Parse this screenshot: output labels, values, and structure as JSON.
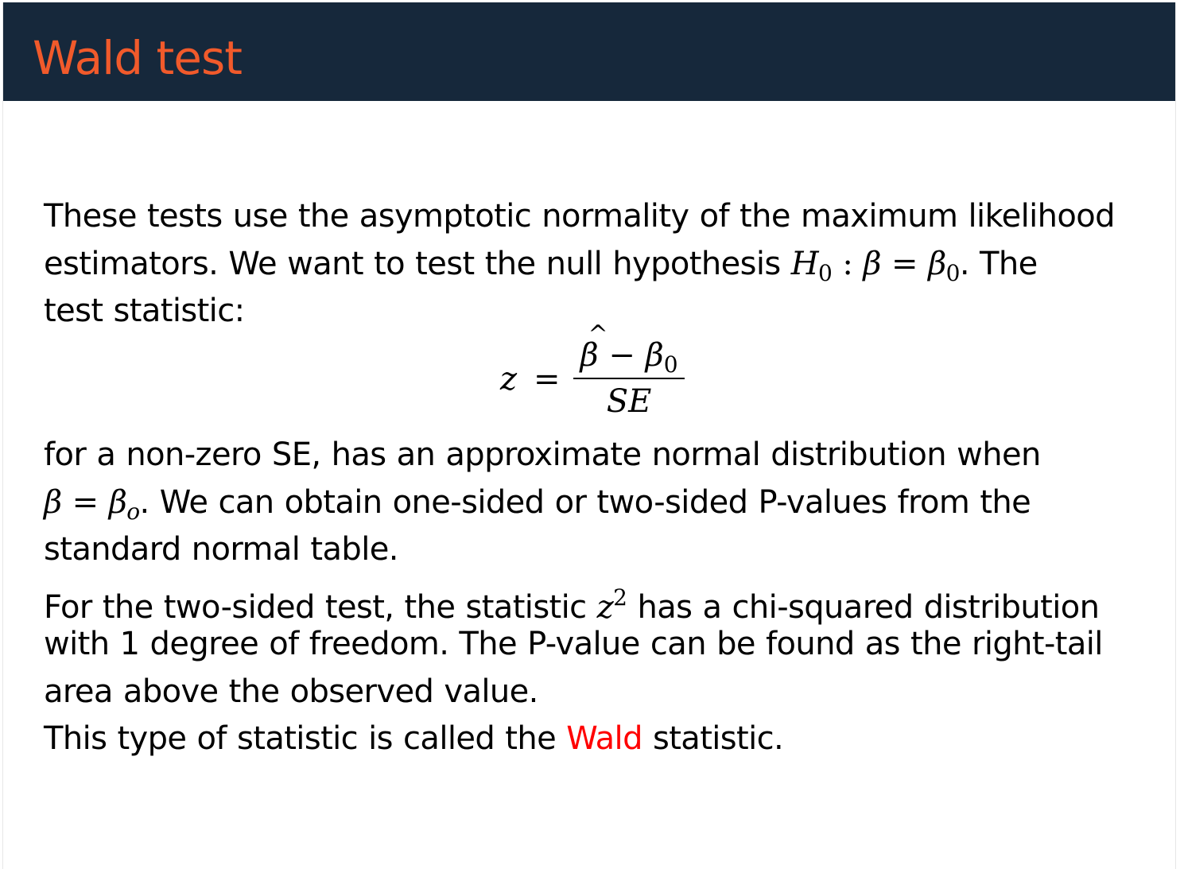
{
  "slide": {
    "title": "Wald test",
    "colors": {
      "header_bg": "#16283b",
      "title": "#f15a2b",
      "highlight": "#ff0000"
    }
  },
  "content": {
    "p1_l1": "These tests use the asymptotic normality of the maximum likelihood",
    "p1_l2_text": "estimators. We want to test the null hypothesis ",
    "p1_l2_H": "H",
    "p1_l2_H_sub": "0",
    "p1_l2_colon": " : ",
    "p1_l2_beta": "β",
    "p1_l2_eq": " = ",
    "p1_l2_beta0": "β",
    "p1_l2_beta0_sub": "0",
    "p1_l2_end": ". The",
    "p1_l3": "test statistic:",
    "eq_lhs": "z",
    "eq_equals": "=",
    "eq_num_beta": "β",
    "eq_num_hat": "^",
    "eq_num_minus": " − ",
    "eq_num_beta0": "β",
    "eq_num_beta0_sub": "0",
    "eq_den": "SE",
    "p2_l1": "for a non-zero SE, has an approximate normal distribution when",
    "p2_l2_beta": "β",
    "p2_l2_eq": " = ",
    "p2_l2_betao": "β",
    "p2_l2_betao_sub": "o",
    "p2_l2_rest": ". We can obtain one-sided or two-sided P-values from the",
    "p2_l3": "standard normal table.",
    "p3_l1_text": "For the two-sided test, the statistic ",
    "p3_l1_z": "z",
    "p3_l1_sup": "2",
    "p3_l1_rest": " has a chi-squared distribution",
    "p3_l2": "with 1 degree of freedom. The P-value can be found as the right-tail",
    "p3_l3": "area above the observed value.",
    "p4_before": "This type of statistic is called the ",
    "p4_highlight": "Wald",
    "p4_after": " statistic."
  }
}
